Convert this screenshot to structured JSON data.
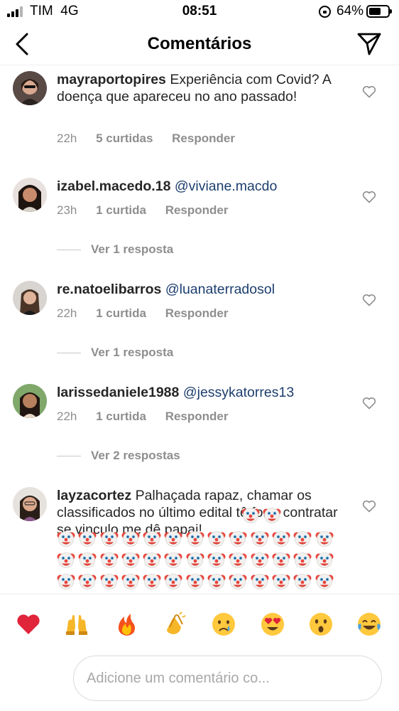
{
  "status_bar": {
    "carrier": "TIM",
    "network": "4G",
    "time": "08:51",
    "battery_text": "64%",
    "battery_level": 0.64
  },
  "header": {
    "title": "Comentários"
  },
  "comments": [
    {
      "username": "mayraportopires",
      "text": "Experiência com Covid? A doença que apareceu no ano passado!",
      "time": "22h",
      "likes": "5 curtidas",
      "reply_label": "Responder"
    },
    {
      "username": "izabel.macedo.18",
      "mention": "@viviane.macdo",
      "time": "23h",
      "likes": "1 curtida",
      "reply_label": "Responder",
      "view_replies": "Ver 1 resposta"
    },
    {
      "username": "re.natoelibarros",
      "mention": "@luanaterradosol",
      "time": "22h",
      "likes": "1 curtida",
      "reply_label": "Responder",
      "view_replies": "Ver 1 resposta"
    },
    {
      "username": "larissedaniele1988",
      "mention": "@jessykatorres13",
      "time": "22h",
      "likes": "1 curtida",
      "reply_label": "Responder",
      "view_replies": "Ver 2 respostas"
    },
    {
      "username": "layzacortez",
      "text": "Palhaçada rapaz,  chamar os classificados no último edital tô fora, contratar se vinculo me dê papai!",
      "emoji_name": "clown-face",
      "emoji_count": 41
    }
  ],
  "reactions": [
    "red-heart",
    "raising-hands",
    "fire",
    "clapping-hands",
    "crying-face",
    "heart-eyes",
    "astonished-face",
    "tears-of-joy"
  ],
  "input": {
    "placeholder": "Adicione um comentário co..."
  },
  "colors": {
    "mention": "#1c3e6e",
    "meta_text": "#8e8e8e",
    "heart": "#e0245e"
  }
}
